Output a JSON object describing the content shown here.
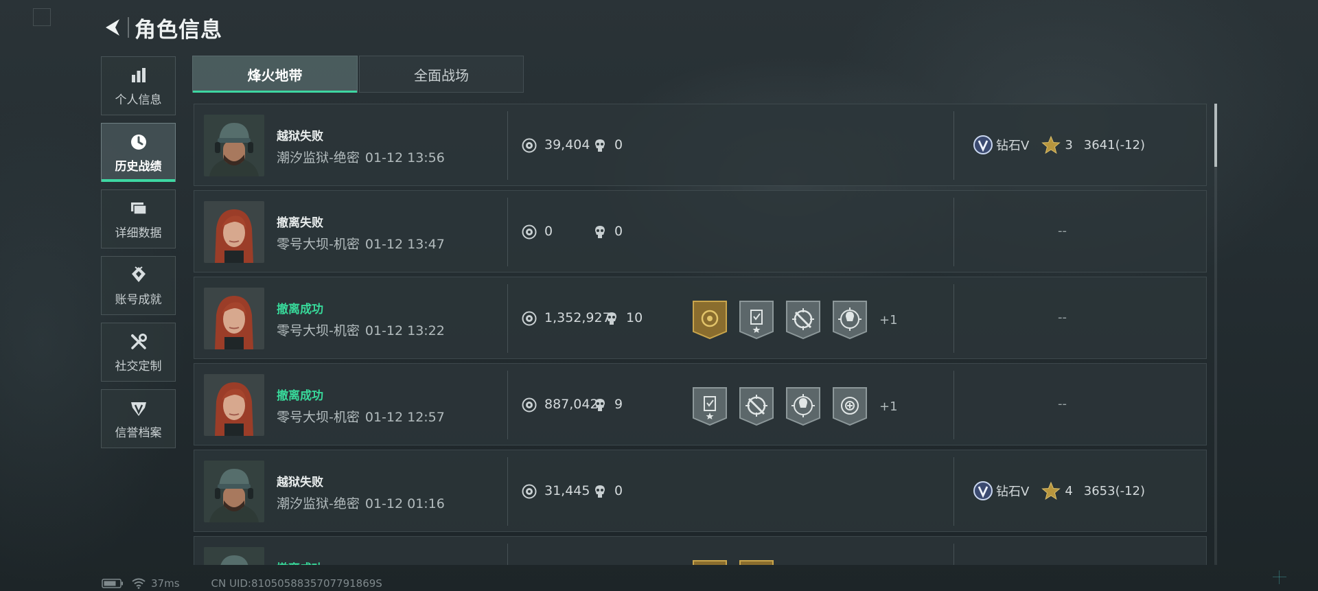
{
  "header": {
    "title": "角色信息"
  },
  "sidebar": {
    "items": [
      {
        "label": "个人信息",
        "icon": "bar-chart-icon",
        "active": false
      },
      {
        "label": "历史战绩",
        "icon": "clock-icon",
        "active": true
      },
      {
        "label": "详细数据",
        "icon": "cards-icon",
        "active": false
      },
      {
        "label": "账号成就",
        "icon": "medal-diamond-icon",
        "active": false
      },
      {
        "label": "社交定制",
        "icon": "tools-icon",
        "active": false
      },
      {
        "label": "信誉档案",
        "icon": "shield-emblem-icon",
        "active": false
      }
    ]
  },
  "tabs": [
    {
      "label": "烽火地带",
      "active": true
    },
    {
      "label": "全面战场",
      "active": false
    }
  ],
  "matches": [
    {
      "result": "越狱失败",
      "success": false,
      "map": "潮汐监狱-绝密",
      "time": "01-12 13:56",
      "money": "39,404",
      "kills": "0",
      "badges": [],
      "more": "",
      "rank_name": "钻石V",
      "rank_stars": "3",
      "rank_score": "3641(-12)",
      "rank_empty": ""
    },
    {
      "result": "撤离失败",
      "success": false,
      "map": "零号大坝-机密",
      "time": "01-12 13:47",
      "money": "0",
      "kills": "0",
      "badges": [],
      "more": "",
      "rank_name": "",
      "rank_stars": "",
      "rank_score": "",
      "rank_empty": "--"
    },
    {
      "result": "撤离成功",
      "success": true,
      "map": "零号大坝-机密",
      "time": "01-12 13:22",
      "money": "1,352,927",
      "kills": "10",
      "badges": [
        "gold-emblem",
        "clipboard-star",
        "crosshair-slash",
        "skull-target"
      ],
      "more": "+1",
      "rank_name": "",
      "rank_stars": "",
      "rank_score": "",
      "rank_empty": "--"
    },
    {
      "result": "撤离成功",
      "success": true,
      "map": "零号大坝-机密",
      "time": "01-12 12:57",
      "money": "887,042",
      "kills": "9",
      "badges": [
        "clipboard-star",
        "crosshair-slash",
        "skull-target",
        "plus-target"
      ],
      "more": "+1",
      "rank_name": "",
      "rank_stars": "",
      "rank_score": "",
      "rank_empty": "--"
    },
    {
      "result": "越狱失败",
      "success": false,
      "map": "潮汐监狱-绝密",
      "time": "01-12 01:16",
      "money": "31,445",
      "kills": "0",
      "badges": [],
      "more": "",
      "rank_name": "钻石V",
      "rank_stars": "4",
      "rank_score": "3653(-12)",
      "rank_empty": ""
    },
    {
      "result": "撤离成功",
      "success": true,
      "map": "",
      "time": "",
      "money": "",
      "kills": "",
      "badges": [
        "gold-emblem",
        "gold-emblem"
      ],
      "more": "",
      "rank_name": "",
      "rank_stars": "",
      "rank_score": "",
      "rank_empty": ""
    }
  ],
  "status": {
    "ping": "37ms",
    "uid": "CN UID:8105058835707791869S"
  },
  "colors": {
    "accent": "#3ed7a2",
    "success": "#38d99a",
    "gold": "#b8963e"
  }
}
